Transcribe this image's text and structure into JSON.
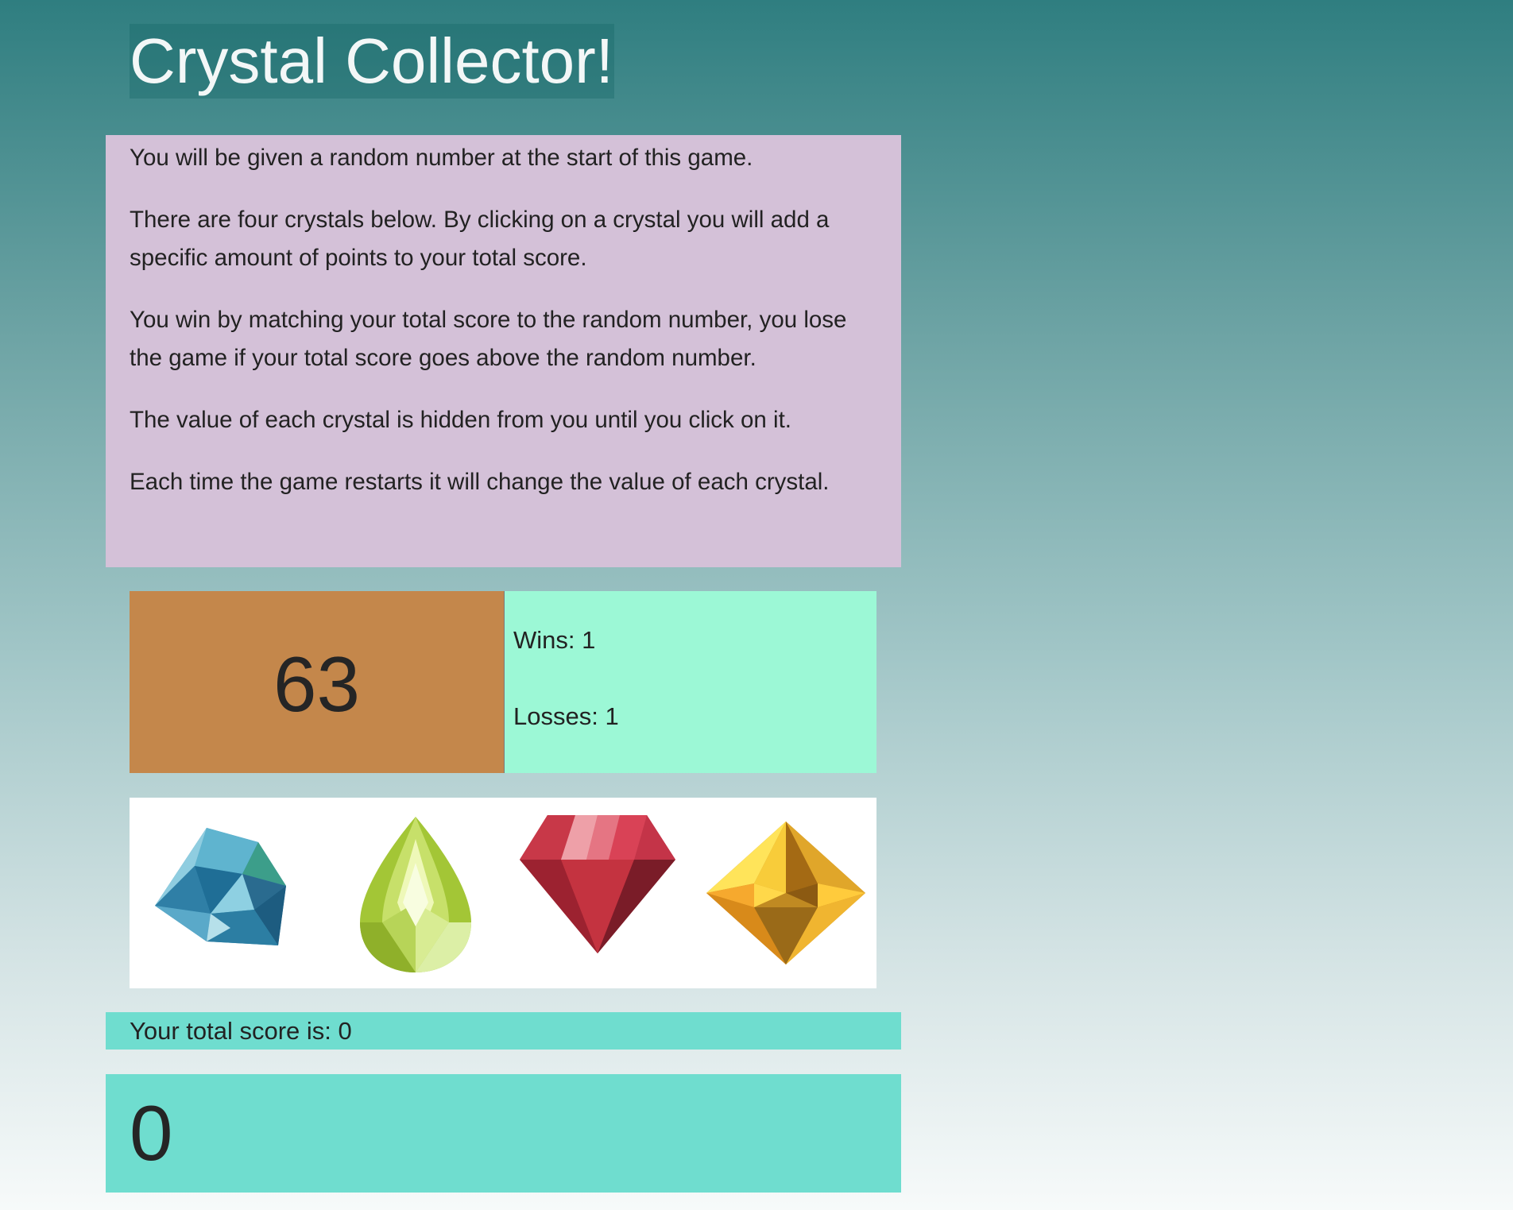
{
  "title": "Crystal Collector!",
  "instructions": [
    "You will be given a random number at the start of this game.",
    "There are four crystals below. By clicking on a crystal you will add a specific amount of points to your total score.",
    "You win by matching your total score to the random number, you lose the game if your total score goes above the random number.",
    "The value of each crystal is hidden from you until you click on it.",
    "Each time the game restarts it will change the value of each crystal."
  ],
  "target_number": "63",
  "stats": {
    "wins": "Wins: 1",
    "losses": "Losses: 1"
  },
  "crystals": [
    {
      "name": "blue-crystal",
      "color": "#3a96b8"
    },
    {
      "name": "green-crystal",
      "color": "#a6cc3c"
    },
    {
      "name": "red-crystal",
      "color": "#c42d3f"
    },
    {
      "name": "yellow-crystal",
      "color": "#d99a1e"
    }
  ],
  "score_label": "Your total score is: 0",
  "total_score": "0",
  "colors": {
    "target_bg": "#c4874b",
    "stats_bg": "#9cf8d6",
    "instructions_bg": "#d4c1d8",
    "score_bg": "#6fddcf"
  }
}
